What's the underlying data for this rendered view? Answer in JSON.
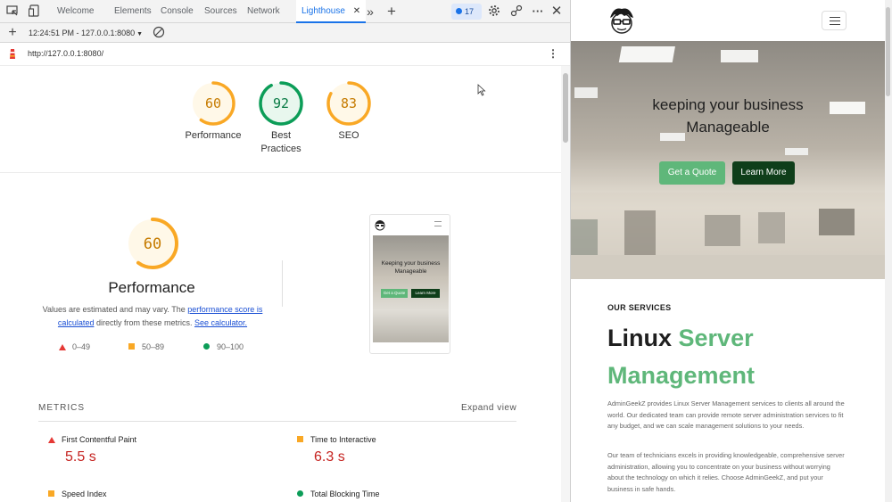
{
  "devtools": {
    "tabs": [
      {
        "label": "Welcome"
      },
      {
        "label": "Elements"
      },
      {
        "label": "Console"
      },
      {
        "label": "Sources"
      },
      {
        "label": "Network"
      },
      {
        "label": "Lighthouse",
        "active": true
      }
    ],
    "issues_count": "17",
    "report_selector": "12:24:51 PM - 127.0.0.1:8080",
    "audited_url": "http://127.0.0.1:8080/"
  },
  "lighthouse": {
    "scores": [
      {
        "label": "Performance",
        "value": 60,
        "color": "#f9a825"
      },
      {
        "label": "Best Practices",
        "value": 92,
        "color": "#0c9d58"
      },
      {
        "label": "SEO",
        "value": 83,
        "color": "#f9a825"
      }
    ],
    "performance": {
      "score": 60,
      "title": "Performance",
      "desc_prefix": "Values are estimated and may vary. The",
      "desc_link1": "performance score is calculated",
      "desc_middle": "directly from these metrics.",
      "desc_link2": "See calculator."
    },
    "legend": [
      {
        "range": "0–49",
        "shape": "triangle",
        "color": "#e53935"
      },
      {
        "range": "50–89",
        "shape": "square",
        "color": "#f9a825"
      },
      {
        "range": "90–100",
        "shape": "circle",
        "color": "#0c9d58"
      }
    ],
    "metrics_heading": "METRICS",
    "expand_label": "Expand view",
    "metrics": [
      {
        "name": "First Contentful Paint",
        "value": "5.5 s",
        "status": "fail"
      },
      {
        "name": "Time to Interactive",
        "value": "6.3 s",
        "status": "average"
      },
      {
        "name": "Speed Index",
        "value": "",
        "status": "average"
      },
      {
        "name": "Total Blocking Time",
        "value": "",
        "status": "pass"
      }
    ],
    "thumbnail": {
      "hero_text": "Keeping your business Manageable",
      "quote_label": "Get a Quote",
      "learn_label": "Learn More"
    }
  },
  "site": {
    "hero_title_line1": "keeping your business",
    "hero_title_line2": "Manageable",
    "quote_button": "Get a Quote",
    "learn_button": "Learn More",
    "eyebrow": "OUR SERVICES",
    "title_dark": "Linux",
    "title_green_1": "Server",
    "title_green_2": "Management",
    "para1": "AdminGeekZ provides Linux Server Management services to clients all around the world. Our dedicated team can provide remote server administration services to fit any budget, and we can scale management solutions to your needs.",
    "para2": "Our team of technicians excels in providing knowledgeable, comprehensive server administration, allowing you to concentrate on your business without worrying about the technology on which it relies. Choose AdminGeekZ, and put your business in safe hands.",
    "accent_green": "#5fb77a",
    "dark_green": "#0f3e1a"
  }
}
